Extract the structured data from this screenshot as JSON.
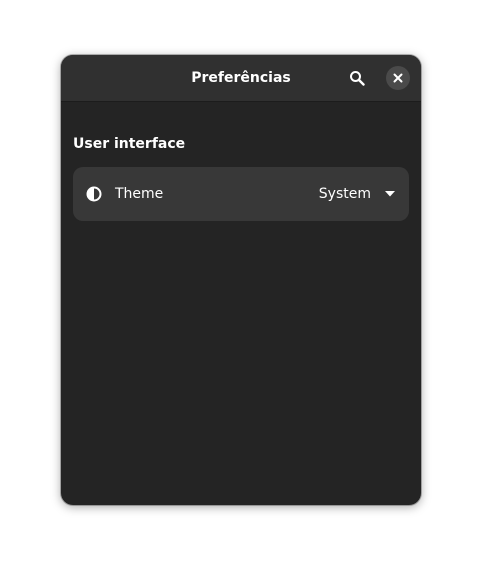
{
  "window": {
    "title": "Preferências"
  },
  "headerbar": {
    "search_icon": "search-icon",
    "close_icon": "close-icon"
  },
  "preferences": {
    "section_title": "User interface",
    "theme_row": {
      "icon": "theme-contrast-icon",
      "label": "Theme",
      "value": "System"
    }
  },
  "colors": {
    "window_bg": "#242424",
    "headerbar_bg": "#303030",
    "row_bg": "#383838",
    "text": "#ffffff"
  }
}
